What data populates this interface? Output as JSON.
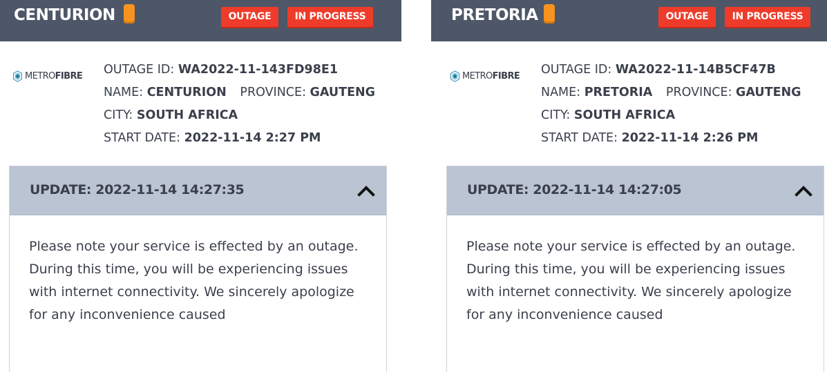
{
  "cards": [
    {
      "title": "CENTURION",
      "badges": {
        "outage": "OUTAGE",
        "in_progress": "IN PROGRESS"
      },
      "logo": {
        "light": "METRO",
        "bold": "FIBRE"
      },
      "outage_id_label": "OUTAGE ID:",
      "outage_id": "WA2022-11-143FD98E1",
      "name_label": "NAME:",
      "name": "CENTURION",
      "province_label": "PROVINCE:",
      "province": "GAUTENG",
      "city_label": "CITY:",
      "city": "SOUTH AFRICA",
      "start_label": "START DATE:",
      "start_date": "2022-11-14 2:27 PM",
      "update_title": "UPDATE: 2022-11-14 14:27:35",
      "update_body": "Please note your service is effected by an outage. During this time, you will be experiencing issues with internet connectivity. We sincerely apologize for any inconvenience caused"
    },
    {
      "title": "PRETORIA",
      "badges": {
        "outage": "OUTAGE",
        "in_progress": "IN PROGRESS"
      },
      "logo": {
        "light": "METRO",
        "bold": "FIBRE"
      },
      "outage_id_label": "OUTAGE ID:",
      "outage_id": "WA2022-11-14B5CF47B",
      "name_label": "NAME:",
      "name": "PRETORIA",
      "province_label": "PROVINCE:",
      "province": "GAUTENG",
      "city_label": "CITY:",
      "city": "SOUTH AFRICA",
      "start_label": "START DATE:",
      "start_date": "2022-11-14 2:26 PM",
      "update_title": "UPDATE: 2022-11-14 14:27:05",
      "update_body": "Please note your service is effected by an outage. During this time, you will be experiencing issues with internet connectivity. We sincerely apologize for any inconvenience caused"
    }
  ],
  "colors": {
    "header_bg": "#4d5767",
    "badge_red": "#ee3b2a",
    "status_orange": "#f7931e",
    "update_head_bg": "#bac4d3"
  },
  "icons": {
    "status": "orange-status-indicator",
    "logo": "metrofibre-hexagon-logo-icon",
    "collapse": "chevron-up-icon"
  }
}
